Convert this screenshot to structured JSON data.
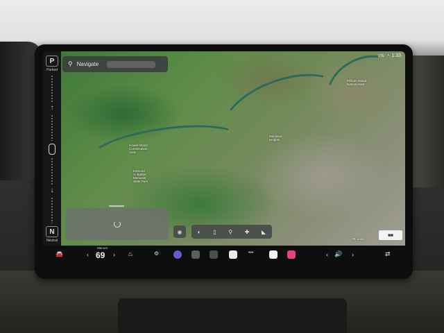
{
  "search": {
    "placeholder": "Navigate",
    "icon": "search-icon"
  },
  "gear": {
    "park": {
      "letter": "P",
      "label": "Parked"
    },
    "neutral": {
      "letter": "N",
      "label": "Neutral"
    }
  },
  "status": {
    "time": "1:33"
  },
  "map_labels": {
    "island": "Howell Island\nConservation\nArea",
    "memorial": "Edmund\nA. Babler\nMemorial\nState Park",
    "wildlife": "Pelican Island\nNatural Area",
    "stlouis": "St. Louis",
    "maryland": "Maryland\nHeights"
  },
  "climate": {
    "mode": "Manual",
    "temp": "69"
  },
  "dock": {
    "apps": [
      {
        "name": "seat-heat-icon",
        "glyph": "⌇"
      },
      {
        "name": "toybox-icon",
        "glyph": "🎮"
      },
      {
        "name": "camera-app-icon",
        "color": "#6b5cc4"
      },
      {
        "name": "dashcam-app-icon",
        "color": "#5a5f5d"
      },
      {
        "name": "theater-app-icon",
        "color": "#4a4d4c"
      },
      {
        "name": "calendar-app-icon",
        "color": "#e9e9e9"
      },
      {
        "name": "more-apps-icon",
        "glyph": "•••"
      },
      {
        "name": "notes-app-icon",
        "color": "#f1f1f1"
      },
      {
        "name": "music-app-icon",
        "color": "#e8437c"
      }
    ]
  },
  "colors": {
    "accent": "#e8437c",
    "dock_bg": "#0d0f0e",
    "map_green": "#3f7a3a"
  }
}
